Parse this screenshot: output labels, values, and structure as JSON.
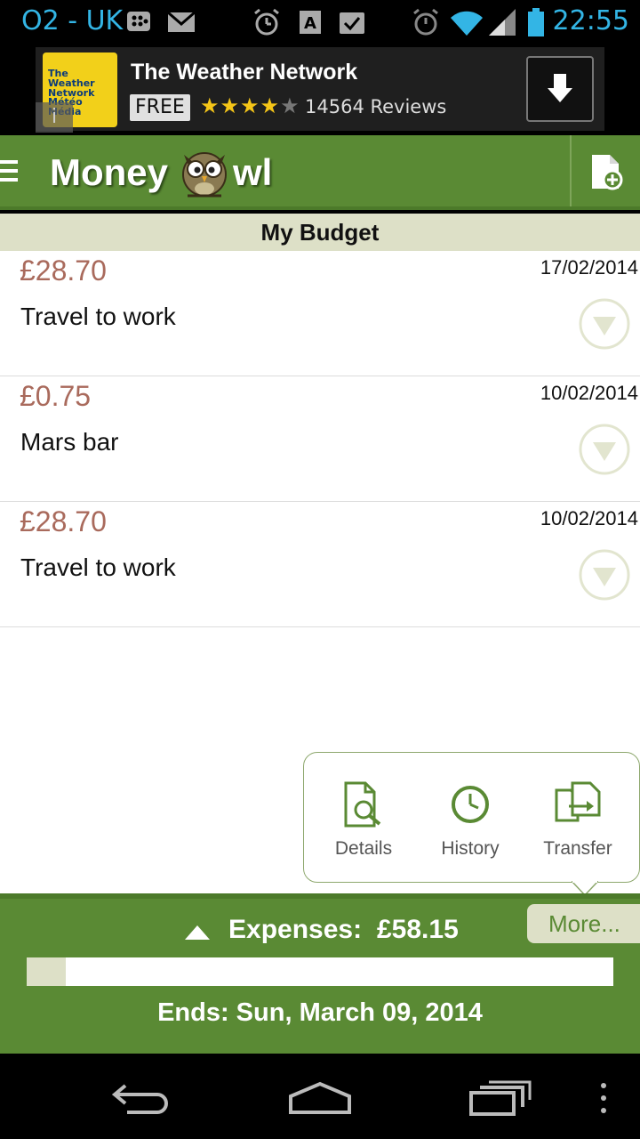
{
  "status_bar": {
    "carrier": "O2 - UK",
    "time": "22:55",
    "icons": [
      "bbm-icon",
      "gmail-icon",
      "alarm-clock-icon",
      "font-icon",
      "task-check-icon",
      "alarm-icon",
      "wifi-icon",
      "signal-icon",
      "battery-icon"
    ]
  },
  "ad": {
    "logo_line1": "The Weather Network",
    "logo_line2": "Météo Média",
    "title": "The Weather Network",
    "price": "FREE",
    "rating": 4,
    "reviews": "14564 Reviews",
    "info_icon": "i"
  },
  "app_bar": {
    "logo_part1": "Money",
    "logo_part2": "wl"
  },
  "section": {
    "title": "My Budget"
  },
  "transactions": [
    {
      "amount": "£28.70",
      "date": "17/02/2014",
      "description": "Travel to work"
    },
    {
      "amount": "£0.75",
      "date": "10/02/2014",
      "description": "Mars bar"
    },
    {
      "amount": "£28.70",
      "date": "10/02/2014",
      "description": "Travel to work"
    }
  ],
  "popup": {
    "details": "Details",
    "history": "History",
    "transfer": "Transfer"
  },
  "footer": {
    "expenses_label": "Expenses:",
    "expenses_value": "£58.15",
    "more_label": "More...",
    "progress_fraction": 0.066,
    "ends_label": "Ends: Sun, March 09, 2014"
  },
  "colors": {
    "brand_green": "#5a8a34",
    "header_beige": "#dde0c7",
    "amount_color": "#a96a5c",
    "status_blue": "#33b5e5"
  }
}
